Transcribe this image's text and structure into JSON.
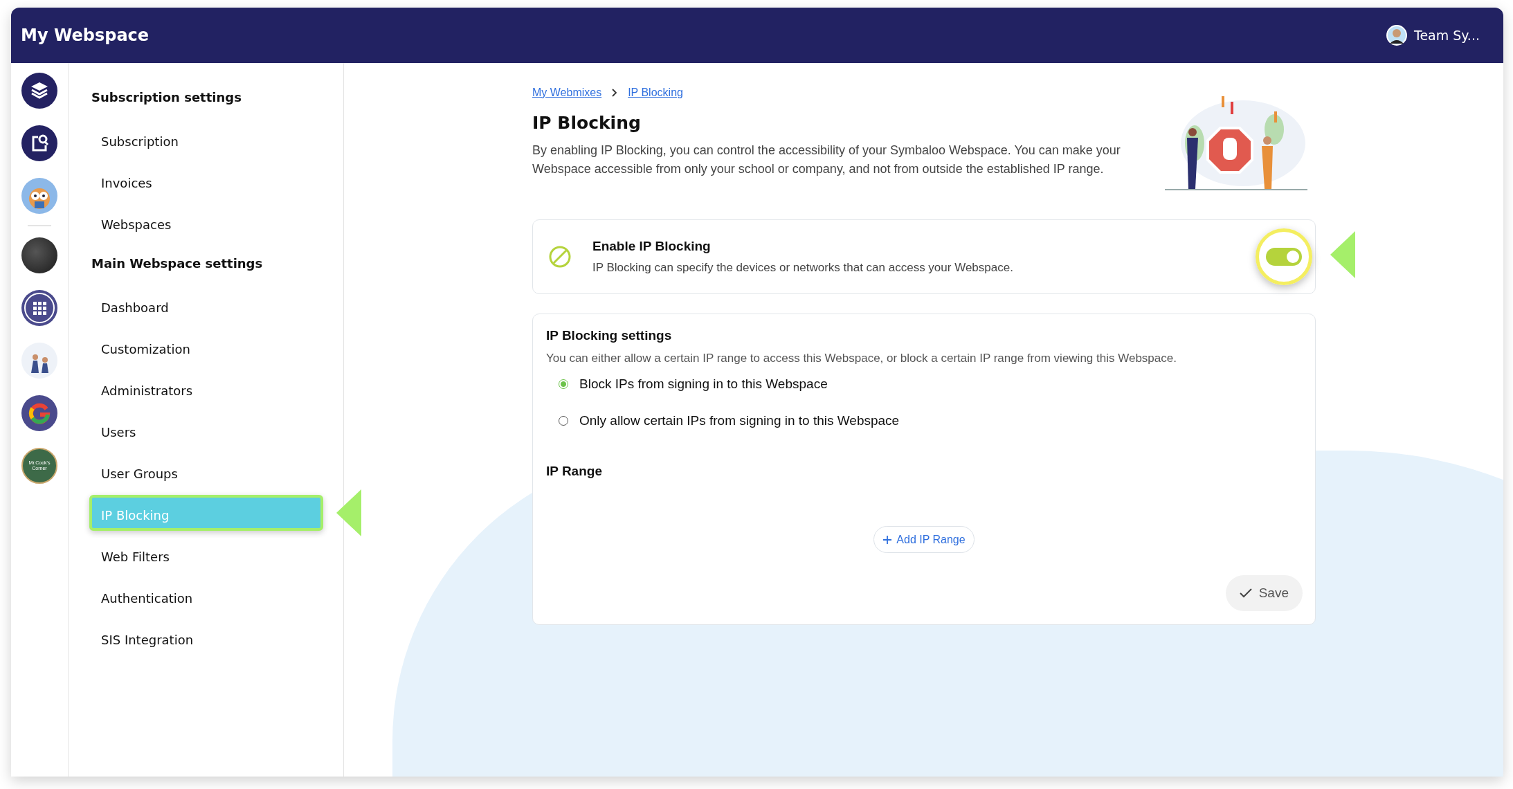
{
  "header": {
    "title": "My Webspace",
    "user": {
      "name": "Team Sy..."
    }
  },
  "rail": [
    {
      "kind": "layers"
    },
    {
      "kind": "search-doc"
    },
    {
      "kind": "owl"
    },
    {
      "kind": "divider"
    },
    {
      "kind": "photo"
    },
    {
      "kind": "grid"
    },
    {
      "kind": "graduates"
    },
    {
      "kind": "g-logo"
    },
    {
      "kind": "badge",
      "label": "Mr.Cook's Corner"
    }
  ],
  "sidebar": {
    "sections": [
      {
        "title": "Subscription settings",
        "items": [
          {
            "label": "Subscription",
            "selected": false
          },
          {
            "label": "Invoices",
            "selected": false
          },
          {
            "label": "Webspaces",
            "selected": false
          }
        ]
      },
      {
        "title": "Main Webspace settings",
        "items": [
          {
            "label": "Dashboard",
            "selected": false
          },
          {
            "label": "Customization",
            "selected": false
          },
          {
            "label": "Administrators",
            "selected": false
          },
          {
            "label": "Users",
            "selected": false
          },
          {
            "label": "User Groups",
            "selected": false
          },
          {
            "label": "IP Blocking",
            "selected": true
          },
          {
            "label": "Web Filters",
            "selected": false
          },
          {
            "label": "Authentication",
            "selected": false
          },
          {
            "label": "SIS Integration",
            "selected": false
          }
        ]
      }
    ]
  },
  "breadcrumb": [
    {
      "label": "My Webmixes"
    },
    {
      "label": "IP Blocking"
    }
  ],
  "page": {
    "title": "IP Blocking",
    "description": "By enabling IP Blocking, you can control the accessibility of your Symbaloo Webspace. You can make your Webspace accessible from only your school or company, and not from outside the established IP range."
  },
  "enable_card": {
    "title": "Enable IP Blocking",
    "description": "IP Blocking can specify the devices or networks that can access your Webspace.",
    "on": true
  },
  "settings_card": {
    "title": "IP Blocking settings",
    "description": "You can either allow a certain IP range to access this Webspace, or block a certain IP range from viewing this Webspace.",
    "options": [
      {
        "label": "Block IPs from signing in to this Webspace",
        "selected": true
      },
      {
        "label": "Only allow certain IPs from signing in to this Webspace",
        "selected": false
      }
    ],
    "range_title": "IP Range",
    "add_button": "Add IP Range",
    "save_button": "Save"
  }
}
